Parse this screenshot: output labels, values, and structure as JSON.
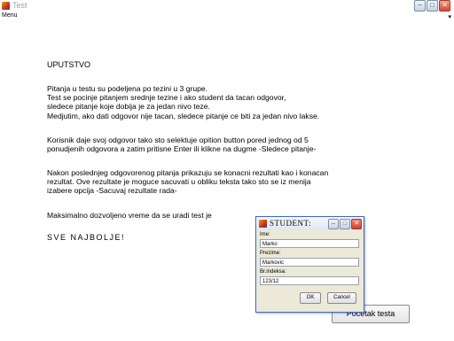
{
  "window": {
    "title": "Test",
    "menu": "Menu",
    "menu_arrow": "▾"
  },
  "controls": {
    "minimize": "–",
    "maximize": "□",
    "close": "✕"
  },
  "content": {
    "heading": "UPUTSTVO",
    "p1": [
      "Pitanja u testu su podeljena po tezini u 3 grupe.",
      "Test se pocinje pitanjem srednje tezine i ako student da tacan odgovor,",
      "sledece pitanje koje dobija je za jedan nivo teze.",
      "Medjutim, ako dati odgovor nije tacan, sledece pitanje ce biti za jedan nivo lakse."
    ],
    "p2": [
      "Korisnik daje svoj odgovor tako sto selektuje opition button pored jednog od 5",
      "ponudjenih odgovora a zatim pritisne Enter ili klikne na dugme -Sledece pitanje-"
    ],
    "p3": [
      "Nakon poslednjeg odgovorenog pitanja prikazuju se konacni rezultati kao i konacan",
      "rezultat. Ove rezultate je moguce sacuvati u obliku teksta tako sto se iz menija",
      "izabere opcija -Sacuvaj rezultate rada-"
    ],
    "p4": "Maksimalno dozvoljeno vreme da se uradi test je",
    "p5": "SVE NAJBOLJE!"
  },
  "start_button": "Pocetak testa",
  "dialog": {
    "title": "STUDENT:",
    "ime_label": "Ime:",
    "ime_value": "Marko",
    "prezime_label": "Prezime:",
    "prezime_value": "Markovic",
    "indeks_label": "Br.indeksa:",
    "indeks_value": "123/12",
    "ok": "OK",
    "cancel": "Cancel"
  }
}
